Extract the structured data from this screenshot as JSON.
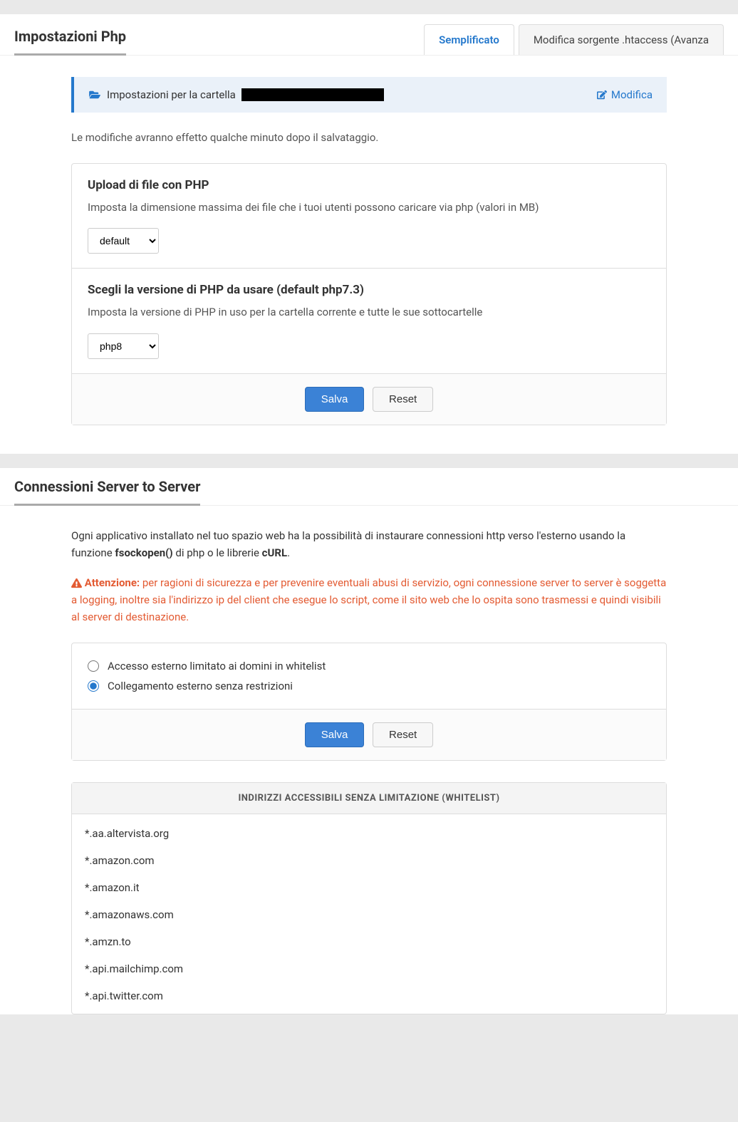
{
  "php": {
    "title": "Impostazioni Php",
    "tabs": {
      "simple": "Semplificato",
      "advanced": "Modifica sorgente .htaccess (Avanza"
    },
    "info_prefix": "Impostazioni per la cartella",
    "edit": "Modifica",
    "note": "Le modifiche avranno effetto qualche minuto dopo il salvataggio.",
    "upload": {
      "title": "Upload di file con PHP",
      "desc": "Imposta la dimensione massima dei file che i tuoi utenti possono caricare via php (valori in MB)",
      "value": "default"
    },
    "version": {
      "title": "Scegli la versione di PHP da usare (default php7.3)",
      "desc": "Imposta la versione di PHP in uso per la cartella corrente e tutte le sue sottocartelle",
      "value": "php8"
    },
    "save": "Salva",
    "reset": "Reset"
  },
  "s2s": {
    "title": "Connessioni Server to Server",
    "intro_a": "Ogni applicativo installato nel tuo spazio web ha la possibilità di instaurare connessioni http verso l'esterno usando la funzione ",
    "intro_b": "fsockopen()",
    "intro_c": " di php o le librerie ",
    "intro_d": "cURL",
    "intro_e": ".",
    "warn_lead": "Attenzione:",
    "warn_body": " per ragioni di sicurezza e per prevenire eventuali abusi di servizio, ogni connessione server to server è soggetta a logging, inoltre sia l'indirizzo ip del client che esegue lo script, come il sito web che lo ospita sono trasmessi e quindi visibili al server di destinazione.",
    "radio_limited": "Accesso esterno limitato ai domini in whitelist",
    "radio_unrestricted": "Collegamento esterno senza restrizioni",
    "save": "Salva",
    "reset": "Reset",
    "whitelist_title": "INDIRIZZI ACCESSIBILI SENZA LIMITAZIONE (WHITELIST)",
    "whitelist": [
      "*.aa.altervista.org",
      "*.amazon.com",
      "*.amazon.it",
      "*.amazonaws.com",
      "*.amzn.to",
      "*.api.mailchimp.com",
      "*.api.twitter.com"
    ]
  }
}
